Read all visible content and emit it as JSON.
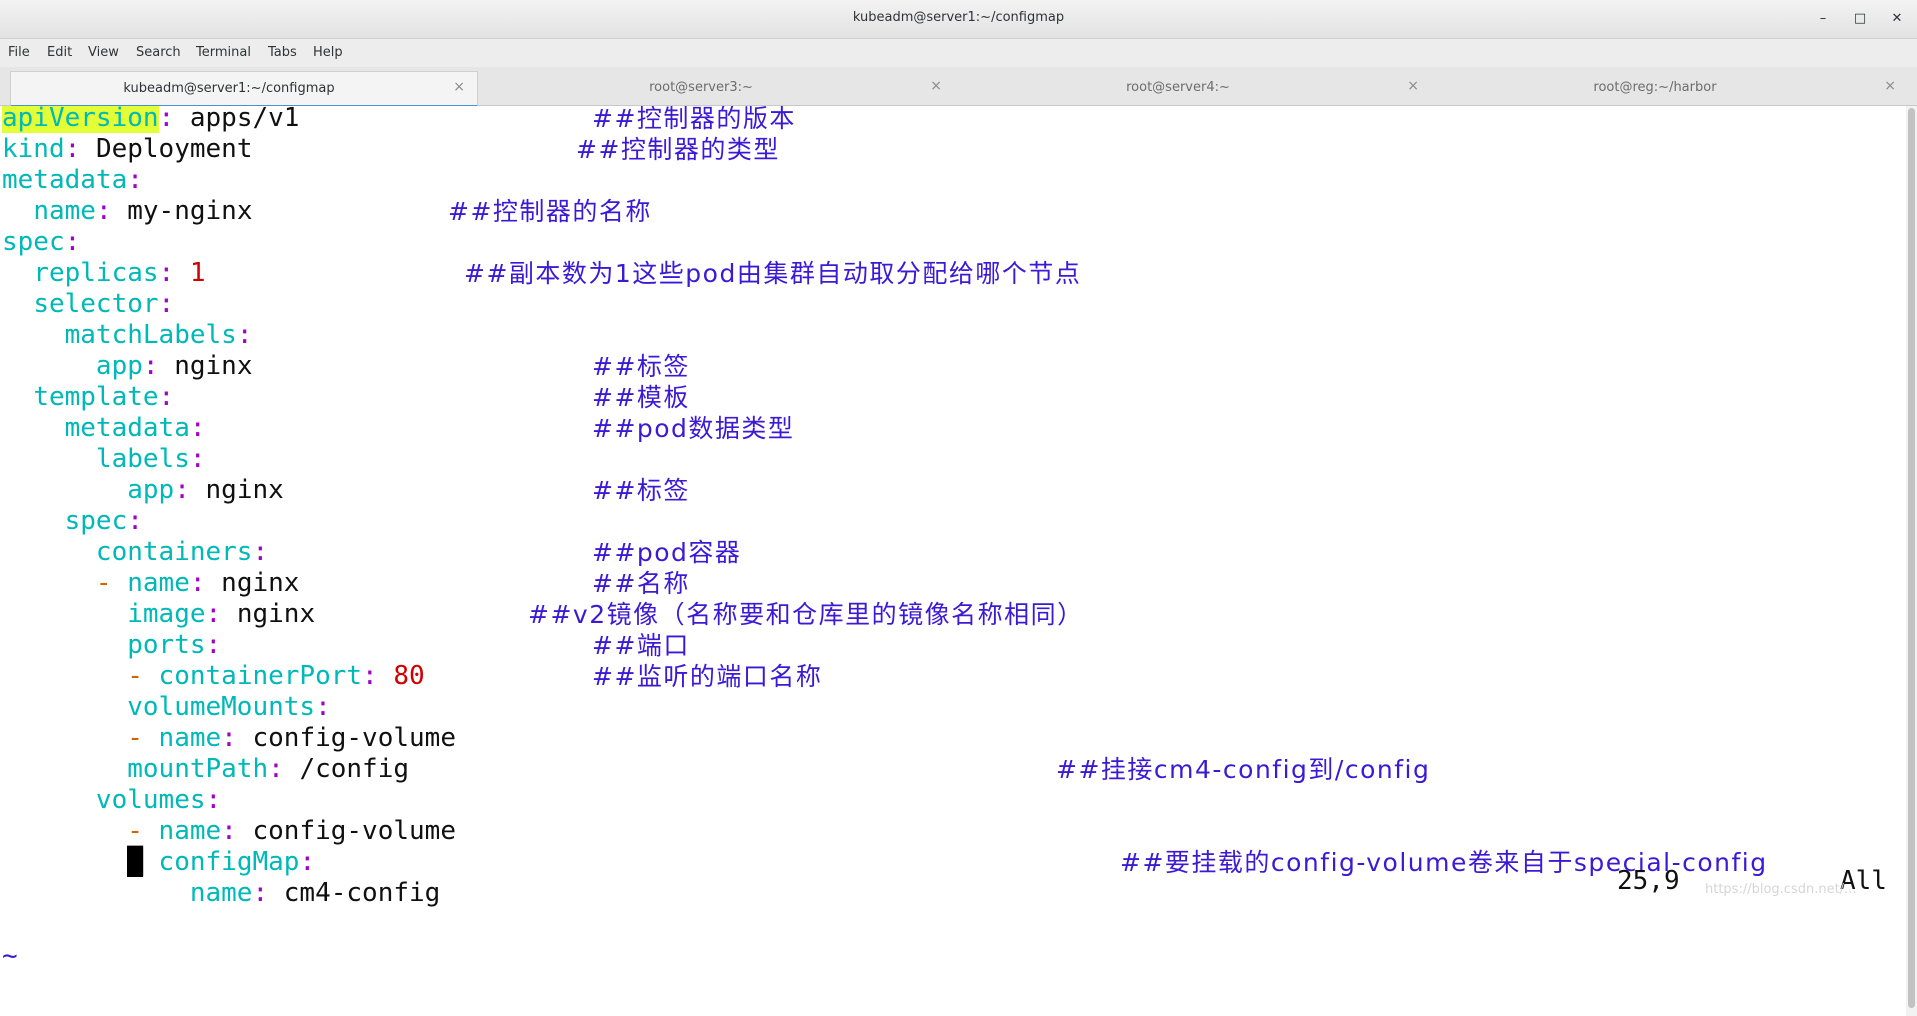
{
  "window": {
    "title": "kubeadm@server1:~/configmap",
    "minimize": "–",
    "maximize": "□",
    "close": "✕"
  },
  "menu": [
    "File",
    "Edit",
    "View",
    "Search",
    "Terminal",
    "Tabs",
    "Help"
  ],
  "tabs": [
    {
      "label": "kubeadm@server1:~/configmap",
      "active": true
    },
    {
      "label": "root@server3:~",
      "active": false
    },
    {
      "label": "root@server4:~",
      "active": false
    },
    {
      "label": "root@reg:~/harbor",
      "active": false
    }
  ],
  "tab_close": "×",
  "lines": [
    {
      "k": "apiVersion",
      "v": "apps/v1"
    },
    {
      "k": "kind",
      "v": "Deployment"
    },
    {
      "k": "metadata",
      "v": ""
    },
    {
      "k": "name",
      "v": "my-nginx"
    },
    {
      "k": "spec",
      "v": ""
    },
    {
      "k": "replicas",
      "v": "1"
    },
    {
      "k": "selector",
      "v": ""
    },
    {
      "k": "matchLabels",
      "v": ""
    },
    {
      "k": "app",
      "v": "nginx"
    },
    {
      "k": "template",
      "v": ""
    },
    {
      "k": "metadata",
      "v": ""
    },
    {
      "k": "labels",
      "v": ""
    },
    {
      "k": "app",
      "v": "nginx"
    },
    {
      "k": "spec",
      "v": ""
    },
    {
      "k": "containers",
      "v": ""
    },
    {
      "k": "name",
      "v": "nginx"
    },
    {
      "k": "image",
      "v": "nginx"
    },
    {
      "k": "ports",
      "v": ""
    },
    {
      "k": "containerPort",
      "v": "80"
    },
    {
      "k": "volumeMounts",
      "v": ""
    },
    {
      "k": "name",
      "v": "config-volume"
    },
    {
      "k": "mountPath",
      "v": "/config"
    },
    {
      "k": "volumes",
      "v": ""
    },
    {
      "k": "name",
      "v": "config-volume"
    },
    {
      "k": "configMap",
      "v": ""
    },
    {
      "k": "name",
      "v": "cm4-config"
    }
  ],
  "comments": [
    "##控制器的版本",
    "##控制器的类型",
    "##控制器的名称",
    "##副本数为1这些pod由集群自动取分配给哪个节点",
    "##标签",
    "##模板",
    "##pod数据类型",
    "##标签",
    "##pod容器",
    "##名称",
    "##v2镜像（名称要和仓库里的镜像名称相同）",
    "##端口",
    "##监听的端口名称",
    "##挂接cm4-config到/config",
    "##要挂载的config-volume卷来自于special-config"
  ],
  "editor": {
    "tilde": "~",
    "position": "25,9",
    "scroll": "All"
  },
  "watermark": "https://blog.csdn.net/..."
}
